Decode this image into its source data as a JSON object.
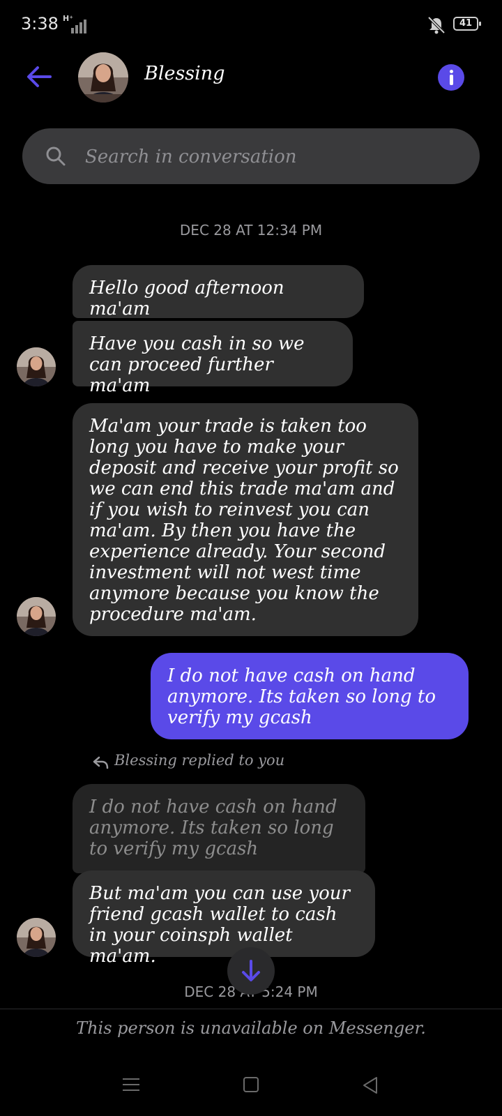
{
  "status_bar": {
    "time": "3:38",
    "network": "H⁺",
    "battery": "41"
  },
  "header": {
    "contact_name": "Blessing"
  },
  "search": {
    "placeholder": "Search in conversation"
  },
  "conversation": {
    "timestamp_1": "DEC 28 AT 12:34 PM",
    "msg_1": "Hello good afternoon ma'am",
    "msg_2": "Have you cash in so we can proceed further ma'am",
    "msg_3": "Ma'am your trade is taken too long you have to make your deposit and receive your profit so we can end this trade ma'am and if you wish to reinvest you can ma'am. By then you have the experience already.  Your second investment will not west time anymore because you know the procedure ma'am.",
    "msg_4_outgoing": "I do not have cash on hand anymore. Its taken so long to verify my gcash",
    "reply_label": "Blessing replied to you",
    "quoted_msg": "I do not have cash on hand anymore. Its taken so long to verify my gcash",
    "msg_5": "But ma'am you can use your friend gcash wallet to cash in your coinsph wallet ma'am.",
    "timestamp_2": "DEC 28 AT 5:24 PM"
  },
  "footer": {
    "unavailable_note": "This person is unavailable on Messenger."
  },
  "colors": {
    "accent": "#5a4ae8",
    "incoming_bubble": "#303030",
    "background": "#000000"
  },
  "icons": [
    "back-arrow-icon",
    "info-icon",
    "search-icon",
    "reply-icon",
    "arrow-down-icon",
    "mute-icon"
  ]
}
